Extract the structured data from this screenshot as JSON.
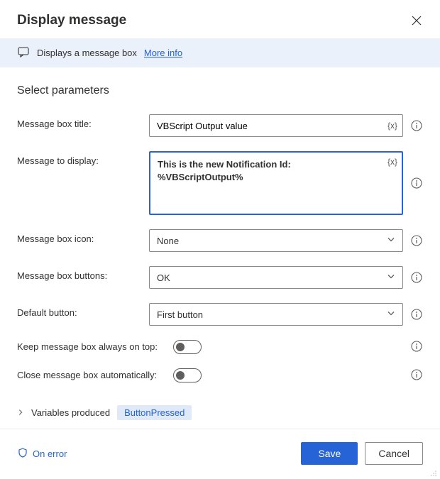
{
  "header": {
    "title": "Display message"
  },
  "banner": {
    "text": "Displays a message box",
    "link": "More info"
  },
  "section": {
    "title": "Select parameters"
  },
  "fields": {
    "title": {
      "label": "Message box title:",
      "value": "VBScript Output value",
      "var_hint": "{x}"
    },
    "message": {
      "label": "Message to display:",
      "value": "This is the new Notification Id: %VBScriptOutput%",
      "var_hint": "{x}"
    },
    "icon": {
      "label": "Message box icon:",
      "value": "None"
    },
    "buttons": {
      "label": "Message box buttons:",
      "value": "OK"
    },
    "default_button": {
      "label": "Default button:",
      "value": "First button"
    },
    "always_on_top": {
      "label": "Keep message box always on top:",
      "on": false
    },
    "auto_close": {
      "label": "Close message box automatically:",
      "on": false
    }
  },
  "variables_produced": {
    "label": "Variables produced",
    "items": [
      "ButtonPressed"
    ]
  },
  "footer": {
    "on_error": "On error",
    "save": "Save",
    "cancel": "Cancel"
  }
}
